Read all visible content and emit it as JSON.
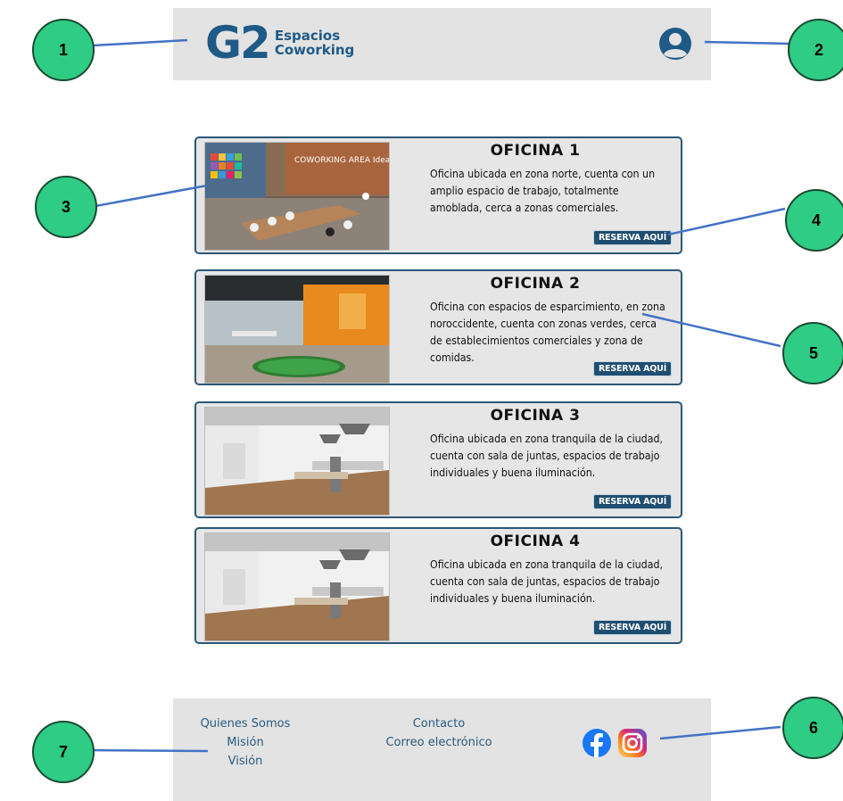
{
  "header": {
    "logo_mark": "G2",
    "logo_line1": "Espacios",
    "logo_line2": "Coworking"
  },
  "offices": [
    {
      "title": "OFICINA 1",
      "description": "Oficina ubicada en zona norte, cuenta con un amplio espacio de trabajo, totalmente amoblada, cerca a zonas comerciales.",
      "button": "RESERVA AQUÍ",
      "image_caption": "COWORKING AREA Ideas start here"
    },
    {
      "title": "OFICINA 2",
      "description": "Oficina con espacios de esparcimiento, en zona noroccidente, cuenta con zonas verdes, cerca de establecimientos comerciales y zona de comidas.",
      "button": "RESERVA AQUÍ"
    },
    {
      "title": "OFICINA 3",
      "description": "Oficina ubicada en zona tranquila de la ciudad, cuenta con sala de juntas, espacios de trabajo individuales y buena iluminación.",
      "button": "RESERVA AQUÍ"
    },
    {
      "title": "OFICINA 4",
      "description": "Oficina ubicada en zona tranquila de la ciudad, cuenta con sala de juntas, espacios de trabajo individuales y buena iluminación.",
      "button": "RESERVA AQUÍ"
    }
  ],
  "footer": {
    "about": "Quienes Somos",
    "mission": "Misión",
    "vision": "Visión",
    "contact": "Contacto",
    "email": "Correo electrónico"
  },
  "callouts": [
    "1",
    "2",
    "3",
    "4",
    "5",
    "6",
    "7"
  ],
  "colors": {
    "brand": "#1f5a87",
    "button": "#1f4e70",
    "callout": "#2ecc84",
    "arrow": "#4472c4"
  },
  "icons": [
    "user-icon",
    "facebook-icon",
    "instagram-icon"
  ]
}
